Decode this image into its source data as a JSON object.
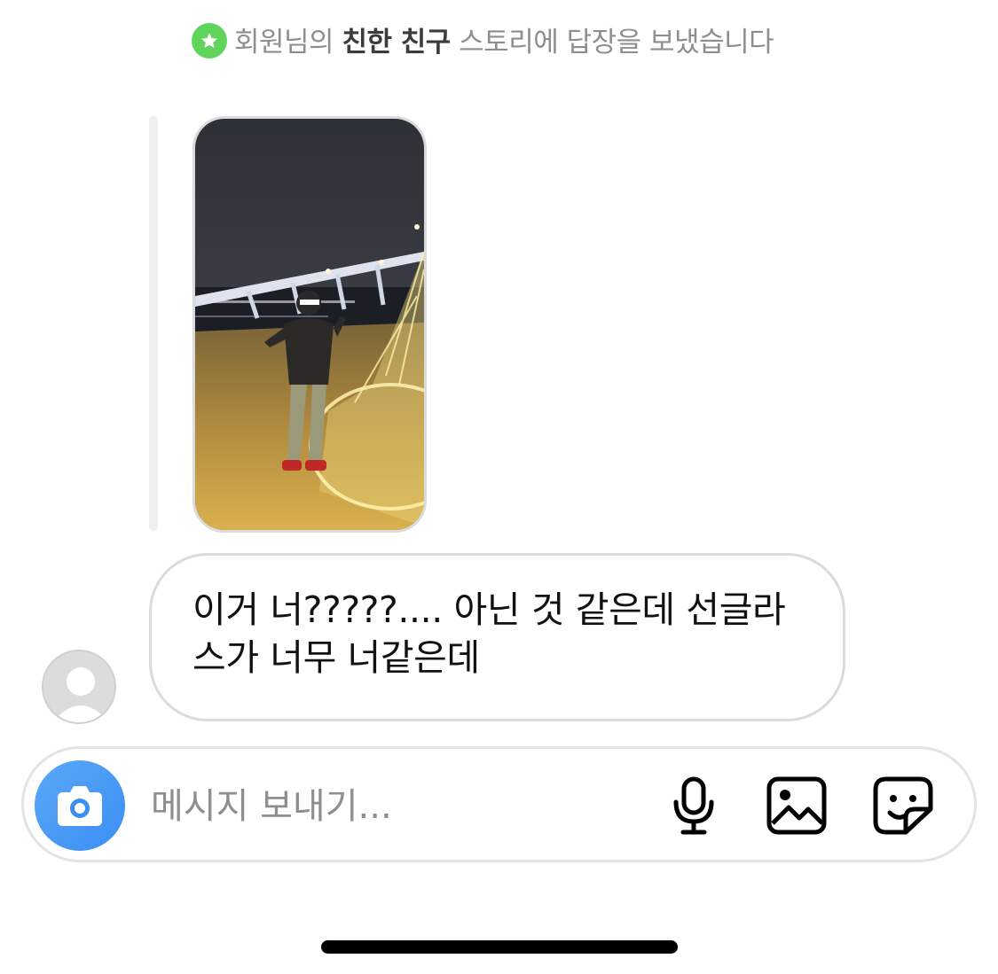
{
  "story_reply": {
    "prefix": "회원님의 ",
    "highlight": "친한 친구",
    "suffix": " 스토리에 답장을 보냈습니다"
  },
  "story": {
    "icon": "close-friends-star-icon",
    "thumbnail": "story-photo"
  },
  "message": {
    "text": "이거 너?????.... 아닌 것 같은데 선글라스가 너무 너같은데"
  },
  "composer": {
    "placeholder": "메시지 보내기...",
    "camera_icon": "camera-icon",
    "mic_icon": "microphone-icon",
    "gallery_icon": "photo-gallery-icon",
    "sticker_icon": "sticker-icon"
  },
  "colors": {
    "close_friends_green": "#5fd35a",
    "camera_blue": "#3b8ef4",
    "bubble_border": "#dbdbdb",
    "muted_text": "#8e8e8e"
  }
}
